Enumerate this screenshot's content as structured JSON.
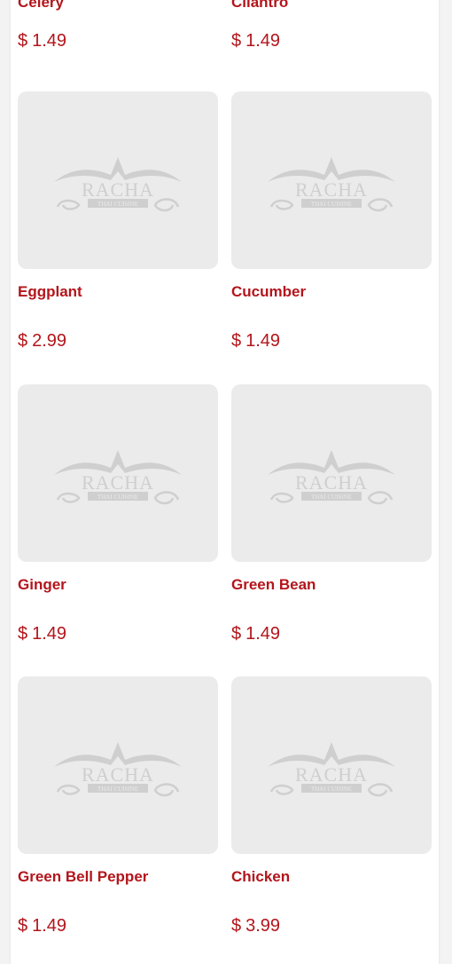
{
  "items": [
    {
      "name": "Celery",
      "price": "1.49",
      "currency": "$",
      "image": "placeholder-logo"
    },
    {
      "name": "Cilantro",
      "price": "1.49",
      "currency": "$",
      "image": "placeholder-logo"
    },
    {
      "name": "Eggplant",
      "price": "2.99",
      "currency": "$",
      "image": "placeholder-logo"
    },
    {
      "name": "Cucumber",
      "price": "1.49",
      "currency": "$",
      "image": "placeholder-logo"
    },
    {
      "name": "Ginger",
      "price": "1.49",
      "currency": "$",
      "image": "placeholder-logo"
    },
    {
      "name": "Green Bean",
      "price": "1.49",
      "currency": "$",
      "image": "placeholder-logo"
    },
    {
      "name": "Green Bell Pepper",
      "price": "1.49",
      "currency": "$",
      "image": "placeholder-logo"
    },
    {
      "name": "Chicken",
      "price": "3.99",
      "currency": "$",
      "image": "placeholder-logo"
    }
  ],
  "placeholder": {
    "logo_text": "RACHA",
    "logo_subtext": "THAI CUISINE"
  },
  "colors": {
    "accent": "#b3151b",
    "placeholder_bg": "#ebebeb",
    "logo": "#cfcfcf"
  }
}
